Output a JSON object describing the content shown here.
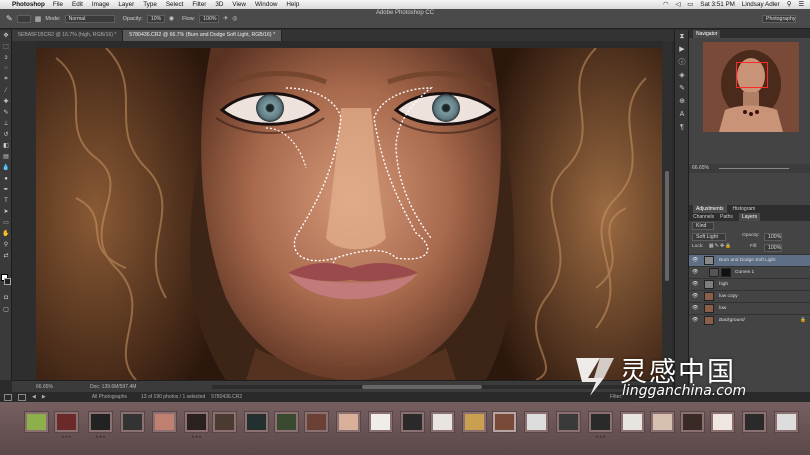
{
  "menubar": {
    "app": "Photoshop",
    "items": [
      "File",
      "Edit",
      "Image",
      "Layer",
      "Type",
      "Select",
      "Filter",
      "3D",
      "View",
      "Window",
      "Help"
    ],
    "clock": "Sat 3:51 PM",
    "user": "Lindsay Adler"
  },
  "window": {
    "title": "Adobe Photoshop CC"
  },
  "options": {
    "mode_label": "Mode:",
    "mode_value": "Normal",
    "opacity_label": "Opacity:",
    "opacity_value": "10%",
    "flow_label": "Flow:",
    "flow_value": "100%",
    "workspace": "Photography"
  },
  "tabs": [
    {
      "label": "5EBA5F1BCR2 @ 16.7% (high, RGB/16) *",
      "active": false
    },
    {
      "label": "5780436.CR2 @ 66.7% (Burn and Dodge Soft Light, RGB/16) *",
      "active": true
    }
  ],
  "status": {
    "zoom": "66.65%",
    "doc": "Doc: 139.6M/597.4M"
  },
  "panels": {
    "navigator_title": "Navigator",
    "zoom_readout": "66.65%",
    "adjustments_tabs": [
      "Adjustments",
      "Histogram"
    ],
    "layer_tabs": [
      "Channels",
      "Paths",
      "Layers"
    ],
    "kind_label": "Kind",
    "blend_mode": "Soft Light",
    "opacity_label": "Opacity:",
    "opacity_value": "100%",
    "lock_label": "Lock:",
    "fill_label": "Fill:",
    "fill_value": "100%",
    "layers": [
      {
        "name": "Burn and Dodge Soft Light",
        "selected": true
      },
      {
        "name": "Curves 1",
        "selected": false
      },
      {
        "name": "high",
        "selected": false
      },
      {
        "name": "low copy",
        "selected": false
      },
      {
        "name": "low",
        "selected": false
      },
      {
        "name": "Background",
        "selected": false
      }
    ]
  },
  "filmbar": {
    "collection": "All Photographs",
    "count": "13 of 190 photos / 1 selected",
    "filename": "5780436.CR2",
    "filter": "Filter:"
  },
  "watermark": {
    "cn": "灵感中国",
    "en": "lingganchina.com"
  }
}
